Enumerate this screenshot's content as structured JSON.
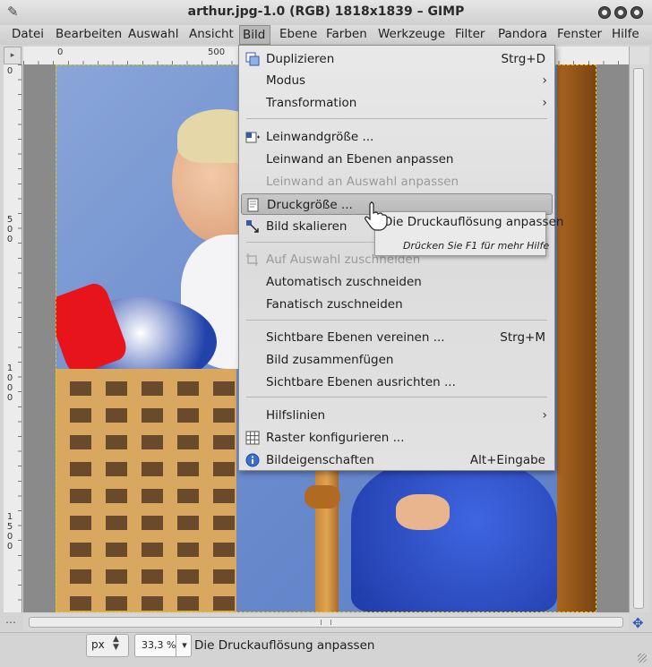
{
  "window": {
    "title": "arthur.jpg-1.0 (RGB) 1818x1839 – GIMP",
    "app_icon": "gimp-icon",
    "buttons": [
      "minimize-button",
      "maximize-button",
      "close-button"
    ]
  },
  "menubar": {
    "items": [
      "Datei",
      "Bearbeiten",
      "Auswahl",
      "Ansicht",
      "Bild",
      "Ebene",
      "Farben",
      "Werkzeuge",
      "Filter",
      "Pandora",
      "Fenster",
      "Hilfe"
    ],
    "active": "Bild"
  },
  "rulers": {
    "h_labels": [
      "0",
      "500"
    ],
    "v_labels": [
      "0",
      "500",
      "1000",
      "1500"
    ]
  },
  "image_menu": {
    "items": [
      {
        "label": "Duplizieren",
        "accel": "Strg+D",
        "icon": "duplicate-icon",
        "submenu": false,
        "enabled": true
      },
      {
        "label": "Modus",
        "accel": "",
        "icon": "",
        "submenu": true,
        "enabled": true
      },
      {
        "label": "Transformation",
        "accel": "",
        "icon": "",
        "submenu": true,
        "enabled": true
      },
      {
        "label": "Leinwandgröße ...",
        "accel": "",
        "icon": "canvas-size-icon",
        "submenu": false,
        "enabled": true
      },
      {
        "label": "Leinwand an Ebenen anpassen",
        "accel": "",
        "icon": "",
        "submenu": false,
        "enabled": true
      },
      {
        "label": "Leinwand an Auswahl anpassen",
        "accel": "",
        "icon": "",
        "submenu": false,
        "enabled": false
      },
      {
        "label": "Druckgröße ...",
        "accel": "",
        "icon": "print-size-icon",
        "submenu": false,
        "enabled": true,
        "highlighted": true
      },
      {
        "label": "Bild skalieren",
        "accel": "",
        "icon": "scale-image-icon",
        "submenu": false,
        "enabled": true
      },
      {
        "label": "Auf Auswahl zuschneiden",
        "accel": "",
        "icon": "crop-icon",
        "submenu": false,
        "enabled": false
      },
      {
        "label": "Automatisch zuschneiden",
        "accel": "",
        "icon": "",
        "submenu": false,
        "enabled": true
      },
      {
        "label": "Fanatisch zuschneiden",
        "accel": "",
        "icon": "",
        "submenu": false,
        "enabled": true
      },
      {
        "label": "Sichtbare Ebenen vereinen ...",
        "accel": "Strg+M",
        "icon": "",
        "submenu": false,
        "enabled": true
      },
      {
        "label": "Bild zusammenfügen",
        "accel": "",
        "icon": "",
        "submenu": false,
        "enabled": true
      },
      {
        "label": "Sichtbare Ebenen ausrichten ...",
        "accel": "",
        "icon": "",
        "submenu": false,
        "enabled": true
      },
      {
        "label": "Hilfslinien",
        "accel": "",
        "icon": "",
        "submenu": true,
        "enabled": true
      },
      {
        "label": "Raster konfigurieren ...",
        "accel": "",
        "icon": "grid-icon",
        "submenu": false,
        "enabled": true
      },
      {
        "label": "Bildeigenschaften",
        "accel": "Alt+Eingabe",
        "icon": "info-icon",
        "submenu": false,
        "enabled": true
      }
    ]
  },
  "tooltip": {
    "text": "Die Druckauflösung anpassen",
    "help": "Drücken Sie F1 für mehr Hilfe"
  },
  "statusbar": {
    "unit": "px",
    "zoom": "33,3 %",
    "message": "Die Druckauflösung anpassen"
  },
  "colors": {
    "menu_bg": "#e2e2e2",
    "highlight": "#bcbcbc",
    "selection_border": "#e8c800",
    "canvas_bg": "#8a8a8a"
  }
}
